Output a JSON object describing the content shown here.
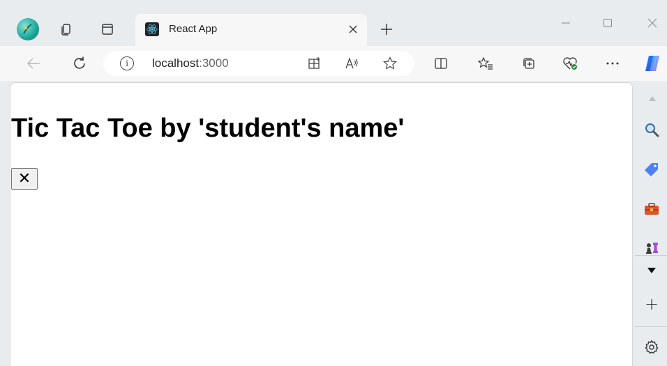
{
  "browser": {
    "tab": {
      "title": "React App"
    },
    "address": {
      "host": "localhost",
      "port": ":3000"
    }
  },
  "page": {
    "title": "Tic Tac Toe by 'student's name'",
    "square_mark": "✕"
  },
  "sidebar": {
    "add_label": "+"
  },
  "colors": {
    "chrome_bg": "#e9ecef",
    "toolbar_bg": "#f7f7f7",
    "page_bg": "#ffffff",
    "button_bg": "#f0f0f0"
  }
}
